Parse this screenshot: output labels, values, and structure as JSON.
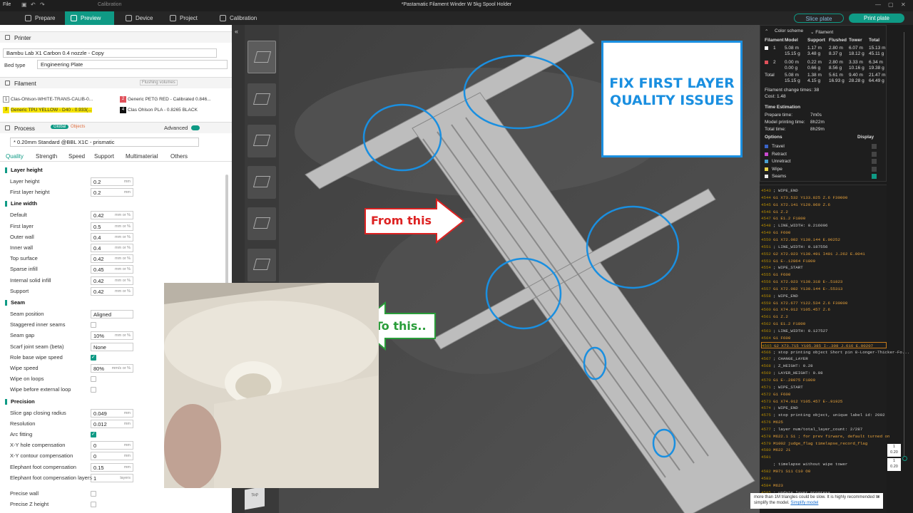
{
  "window": {
    "title": "*Pastamatic Filament Winder W 5kg Spool Holder",
    "file_menu": "File",
    "calibration_ghost": "Calibration"
  },
  "tabs": [
    {
      "label": "Prepare"
    },
    {
      "label": "Preview"
    },
    {
      "label": "Device"
    },
    {
      "label": "Project"
    },
    {
      "label": "Calibration"
    }
  ],
  "actions": {
    "slice": "Slice plate",
    "print": "Print plate"
  },
  "printer": {
    "section": "Printer",
    "name": "Bambu Lab X1 Carbon 0.4 nozzle - Copy",
    "bed_label": "Bed type",
    "bed_value": "Engineering Plate"
  },
  "filament": {
    "section": "Filament",
    "flushing": "Flushing volumes",
    "items": [
      {
        "num": "1",
        "name": "Clas-Ohlson-WHITE-TRANS-CALIB-0...",
        "color": "#ffffff"
      },
      {
        "num": "2",
        "name": "Generic PETG RED - Calibrated 0.846...",
        "color": "#e0505a"
      },
      {
        "num": "3",
        "name": "Generic TPU YELLOW - D40 - 0.933(...",
        "color": "#f5e400"
      },
      {
        "num": "4",
        "name": "Clas Ohlson PLA - 0.8265 BLACK",
        "color": "#111111"
      }
    ]
  },
  "process": {
    "section": "Process",
    "global": "Global",
    "objects": "Objects",
    "advanced": "Advanced",
    "preset": "* 0.20mm Standard @BBL X1C - prismatic",
    "tabs": [
      "Quality",
      "Strength",
      "Speed",
      "Support",
      "Multimaterial",
      "Others"
    ]
  },
  "groups": {
    "layer_height": {
      "title": "Layer height",
      "rows": [
        {
          "label": "Layer height",
          "value": "0.2",
          "unit": "mm"
        },
        {
          "label": "First layer height",
          "value": "0.2",
          "unit": "mm"
        }
      ]
    },
    "line_width": {
      "title": "Line width",
      "rows": [
        {
          "label": "Default",
          "value": "0.42",
          "unit": "mm or %"
        },
        {
          "label": "First layer",
          "value": "0.5",
          "unit": "mm or %"
        },
        {
          "label": "Outer wall",
          "value": "0.4",
          "unit": "mm or %"
        },
        {
          "label": "Inner wall",
          "value": "0.4",
          "unit": "mm or %"
        },
        {
          "label": "Top surface",
          "value": "0.42",
          "unit": "mm or %"
        },
        {
          "label": "Sparse infill",
          "value": "0.45",
          "unit": "mm or %"
        },
        {
          "label": "Internal solid infill",
          "value": "0.42",
          "unit": "mm or %"
        },
        {
          "label": "Support",
          "value": "0.42",
          "unit": "mm or %"
        }
      ]
    },
    "seam": {
      "title": "Seam",
      "rows": [
        {
          "label": "Seam position",
          "value": "Aligned",
          "unit": ""
        },
        {
          "label": "Staggered inner seams",
          "value": "",
          "unit": ""
        },
        {
          "label": "Seam gap",
          "value": "10%",
          "unit": "mm or %"
        },
        {
          "label": "Scarf joint seam (beta)",
          "value": "None",
          "unit": ""
        },
        {
          "label": "Role base wipe speed",
          "value": "",
          "unit": ""
        },
        {
          "label": "Wipe speed",
          "value": "80%",
          "unit": "mm/s or %"
        },
        {
          "label": "Wipe on loops",
          "value": "",
          "unit": ""
        },
        {
          "label": "Wipe before external loop",
          "value": "",
          "unit": ""
        }
      ]
    },
    "precision": {
      "title": "Precision",
      "rows": [
        {
          "label": "Slice gap closing radius",
          "value": "0.049",
          "unit": "mm"
        },
        {
          "label": "Resolution",
          "value": "0.012",
          "unit": "mm"
        },
        {
          "label": "Arc fitting",
          "value": "",
          "unit": ""
        },
        {
          "label": "X-Y hole compensation",
          "value": "0",
          "unit": "mm"
        },
        {
          "label": "X-Y contour compensation",
          "value": "0",
          "unit": "mm"
        },
        {
          "label": "Elephant foot compensation",
          "value": "0.15",
          "unit": "mm"
        },
        {
          "label": "Elephant foot compensation layers",
          "value": "1",
          "unit": "layers"
        },
        {
          "label": "Precise wall",
          "value": "",
          "unit": ""
        },
        {
          "label": "Precise Z height",
          "value": "",
          "unit": ""
        }
      ]
    }
  },
  "legend": {
    "color_scheme": "Color scheme",
    "scheme_value": "Filament",
    "cols": [
      "Filament",
      "Model",
      "Support",
      "Flushed",
      "Tower",
      "Total"
    ],
    "rows": [
      {
        "id": "1",
        "model": "5.08 m\n15.15 g",
        "support": "1.17 m\n3.48 g",
        "flushed": "2.80 m\n8.37 g",
        "tower": "6.07 m\n18.12 g",
        "total": "15.13 m\n45.11 g"
      },
      {
        "id": "2",
        "model": "0.00 m\n0.00 g",
        "support": "0.22 m\n0.66 g",
        "flushed": "2.80 m\n8.56 g",
        "tower": "3.33 m\n10.16 g",
        "total": "6.34 m\n19.38 g"
      },
      {
        "id": "Total",
        "model": "5.08 m\n15.15 g",
        "support": "1.38 m\n4.15 g",
        "flushed": "5.61 m\n16.93 g",
        "tower": "9.40 m\n28.28 g",
        "total": "21.47 m\n64.49 g"
      }
    ],
    "change_times": "Filament change times: 38",
    "cost": "Cost: 1.48",
    "time_title": "Time Estimation",
    "prepare": "Prepare time:",
    "prepare_v": "7m0s",
    "model_time": "Model printing time:",
    "model_time_v": "8h22m",
    "total": "Total time:",
    "total_v": "8h29m",
    "options": "Options",
    "display": "Display",
    "option_items": [
      {
        "label": "Travel",
        "color": "#3a64c8"
      },
      {
        "label": "Retract",
        "color": "#c84ad0"
      },
      {
        "label": "Unretract",
        "color": "#4a9fd0"
      },
      {
        "label": "Wipe",
        "color": "#e6d24a"
      },
      {
        "label": "Seams",
        "color": "#e8e8e8"
      }
    ]
  },
  "gcode": [
    [
      "4543",
      "; WIPE_END"
    ],
    [
      "4544",
      "G1 X73.532 Y133.825 Z.6 F30000"
    ],
    [
      "4545",
      "G1 X72.141 Y129.969 Z.6"
    ],
    [
      "4546",
      "G1 Z.2"
    ],
    [
      "4547",
      "G1 E1.2 F1800"
    ],
    [
      "4548",
      "; LINE_WIDTH: 0.216096"
    ],
    [
      "4549",
      "G1 F600"
    ],
    [
      "4550",
      "G1 X72.082 Y130.144 E.00252"
    ],
    [
      "4551",
      "; LINE_WIDTH: 0.187556"
    ],
    [
      "4552",
      "G2 X72.023 Y130.491 I491 J.262 E.0041"
    ],
    [
      "4553",
      "G1 E-.12864 F1800"
    ],
    [
      "4554",
      "; WIPE_START"
    ],
    [
      "4555",
      "G1 F600"
    ],
    [
      "4556",
      "G1 X72.023 Y130.318 E-.51823"
    ],
    [
      "4557",
      "G1 X72.082 Y130.144 E-.55313"
    ],
    [
      "4558",
      "; WIPE_END"
    ],
    [
      "4559",
      "G1 X72.677 Y122.534 Z.6 F30000"
    ],
    [
      "4560",
      "G1 X74.012 Y105.457 Z.6"
    ],
    [
      "4561",
      "G1 Z.2"
    ],
    [
      "4562",
      "G1 E1.2 F1800"
    ],
    [
      "4563",
      "; LINE_WIDTH: 0.127527"
    ],
    [
      "4564",
      "G1 F600"
    ],
    [
      "4565",
      "G2 X73.715 Y105.385 I-.308 J.616 E.00207"
    ],
    [
      "4566",
      "; stop printing object Short pin 8-Longer-Thicker-Fo..."
    ],
    [
      "4567",
      "; CHANGE_LAYER"
    ],
    [
      "4568",
      "; Z_HEIGHT: 0.28"
    ],
    [
      "4569",
      "; LAYER_HEIGHT: 0.08"
    ],
    [
      "4570",
      "G1 E-.28075 F1800"
    ],
    [
      "4571",
      "; WIPE_START"
    ],
    [
      "4572",
      "G1 F600"
    ],
    [
      "4573",
      "G1 X74.012 Y105.457 E-.91925"
    ],
    [
      "4574",
      "; WIPE_END"
    ],
    [
      "4575",
      "; stop printing object, unique label id: 2002"
    ],
    [
      "4576",
      "M625"
    ],
    [
      "4577",
      "; layer num/total_layer_count: 2/287"
    ],
    [
      "4578",
      "M622.1 S1 ; for prev firware, default turned on"
    ],
    [
      "4579",
      "M1002 judge_flag timelapse_record_flag"
    ],
    [
      "4580",
      "M622 J1"
    ],
    [
      "4581",
      ""
    ],
    [
      "",
      "; timelapse without wipe tower"
    ],
    [
      "4582",
      "M971 S11 C10 O0"
    ],
    [
      "4583",
      ""
    ],
    [
      "4584",
      "M623"
    ],
    [
      "4585",
      "; update layer progress"
    ]
  ],
  "slider": {
    "top_value": "1\n0.20",
    "bottom_value": "1\n0.20"
  },
  "tip": {
    "text": "more than 1M triangles could be slow. It is highly recommended to simplify the model.",
    "link": "Simplify model"
  },
  "callouts": {
    "fix": "FIX FIRST LAYER QUALITY ISSUES",
    "from": "From this",
    "to": "To this.."
  },
  "cube_label": "Top"
}
